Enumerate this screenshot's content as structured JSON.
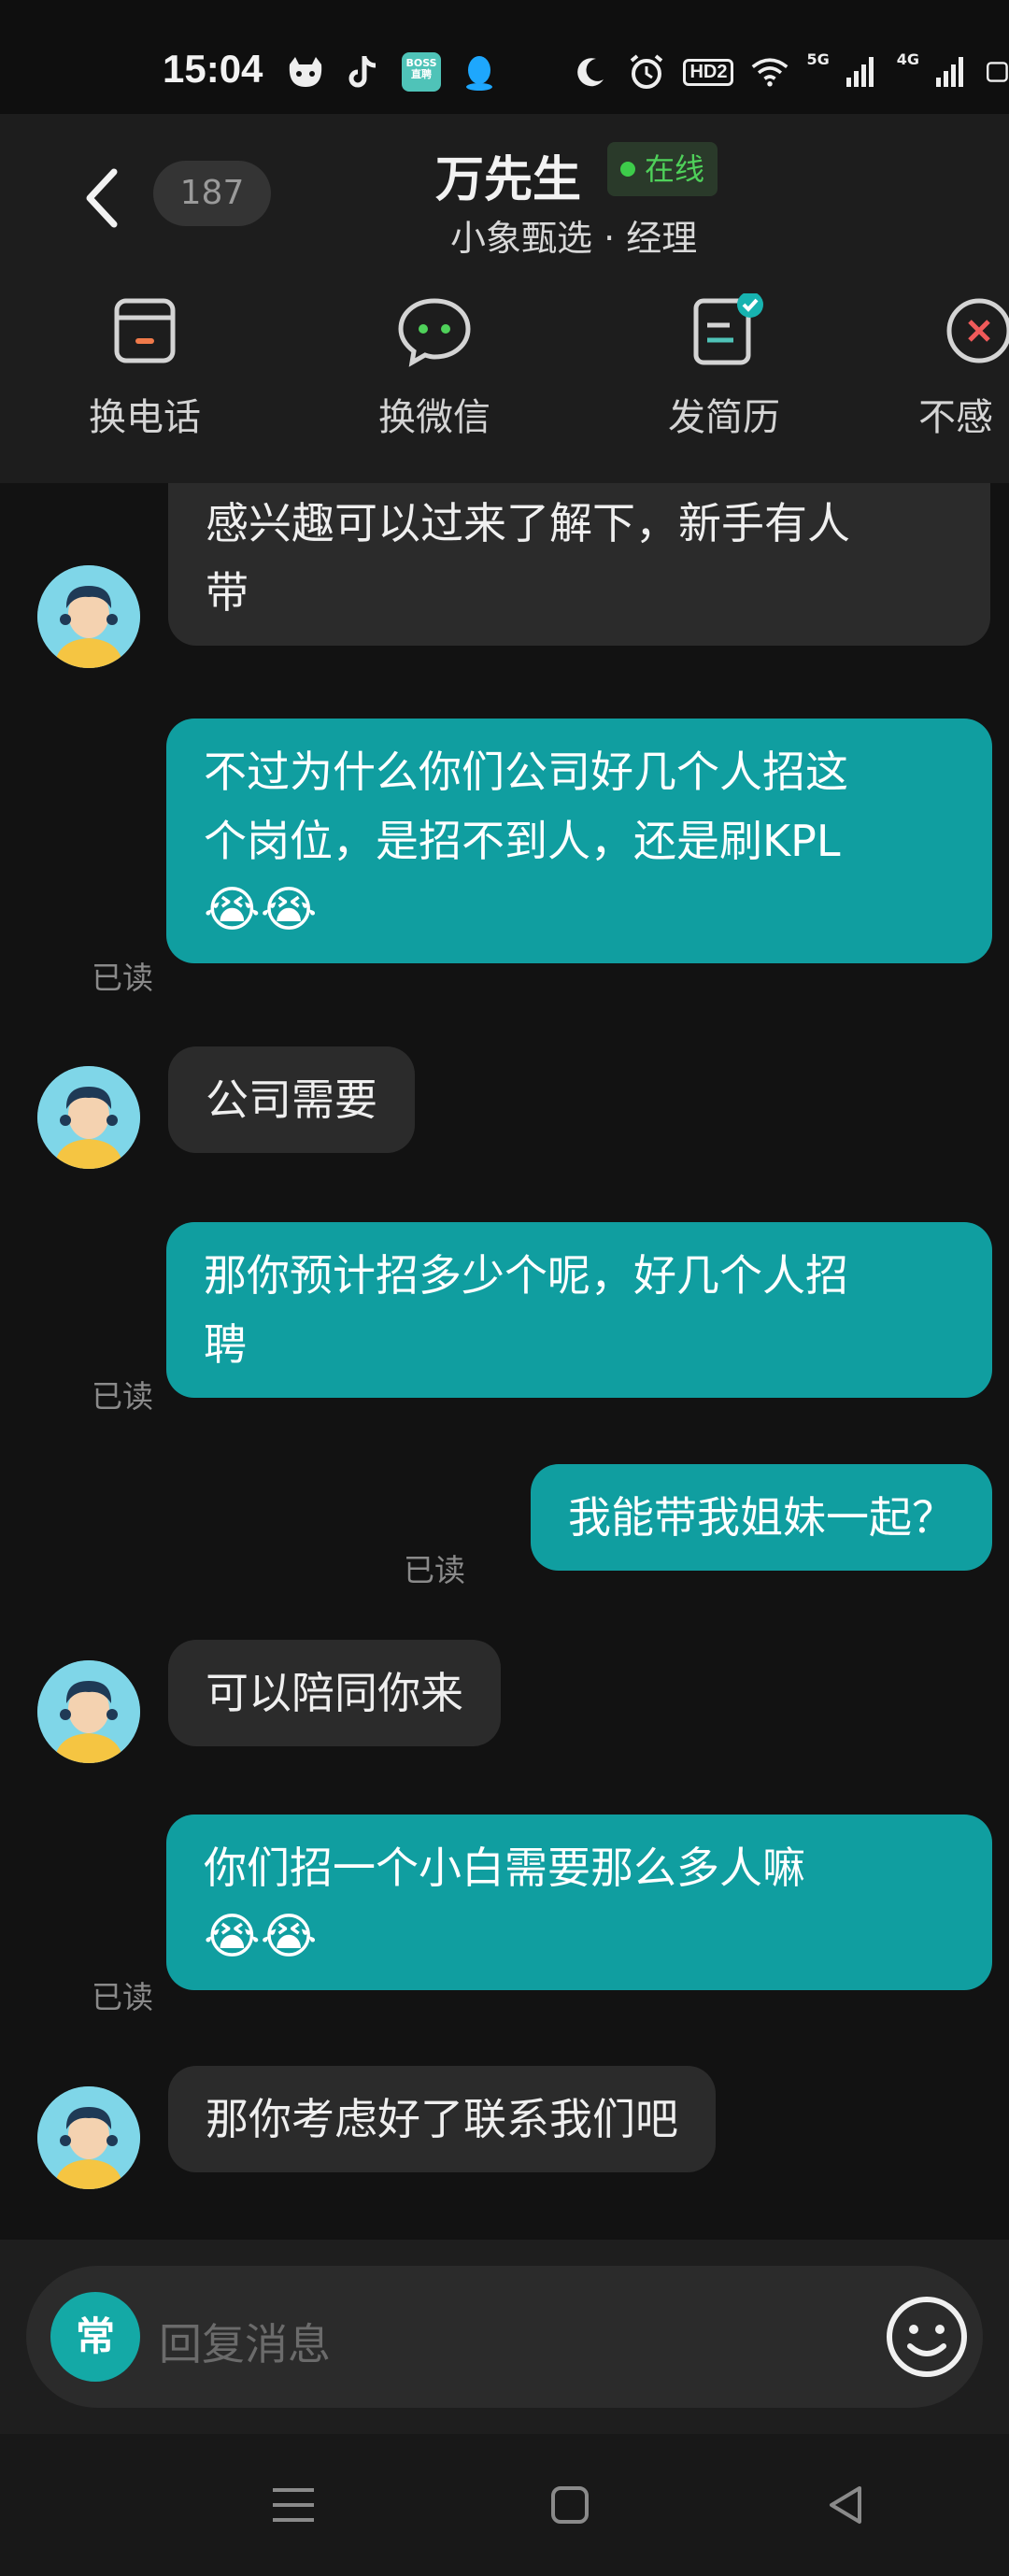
{
  "status_bar": {
    "time": "15:04",
    "app_icons": [
      "cat-app-icon",
      "tiktok-icon",
      "boss-zhipin-icon",
      "qq-icon"
    ],
    "boss_label": "BOSS直聘",
    "hd_label": "HD2",
    "net_5g": "5G",
    "net_4g": "4G",
    "system_icons": [
      "moon-icon",
      "alarm-icon",
      "hd-icon",
      "wifi-icon",
      "signal-5g-icon",
      "signal-4g-icon",
      "battery-icon"
    ]
  },
  "header": {
    "back_icon": "chevron-left-icon",
    "unread_count": "187",
    "contact_name": "万先生",
    "online_status": "在线",
    "contact_subtitle": "小象甄选 · 经理",
    "actions": [
      {
        "label": "换电话",
        "icon": "phone-card-icon"
      },
      {
        "label": "换微信",
        "icon": "wechat-bubble-icon"
      },
      {
        "label": "发简历",
        "icon": "resume-check-icon"
      },
      {
        "label": "不感",
        "icon": "not-interested-icon"
      }
    ]
  },
  "messages": [
    {
      "side": "in",
      "lines": [
        "感兴趣可以过来了解下，新手有人",
        "带"
      ]
    },
    {
      "side": "out",
      "lines": [
        "不过为什么你们公司好几个人招这",
        "个岗位，是招不到人，还是刷KPL"
      ],
      "emoji": "😭😭",
      "read": "已读"
    },
    {
      "side": "in",
      "lines": [
        "公司需要"
      ]
    },
    {
      "side": "out",
      "lines": [
        "那你预计招多少个呢，好几个人招",
        "聘"
      ],
      "read": "已读"
    },
    {
      "side": "out",
      "lines": [
        "我能带我姐妹一起？"
      ],
      "read": "已读"
    },
    {
      "side": "in",
      "lines": [
        "可以陪同你来"
      ]
    },
    {
      "side": "out",
      "lines": [
        "你们招一个小白需要那么多人嘛"
      ],
      "emoji": "😭😭",
      "read": "已读"
    },
    {
      "side": "in",
      "lines": [
        "那你考虑好了联系我们吧"
      ]
    }
  ],
  "input": {
    "common_phrase_label": "常",
    "placeholder": "回复消息",
    "emoji_icon": "smiley-icon"
  },
  "navbar": {
    "icons": [
      "menu-icon",
      "home-square-icon",
      "back-triangle-icon"
    ]
  },
  "colors": {
    "accent_teal": "#109ea0",
    "online_green": "#3dcc4a",
    "incoming_bubble": "#2b2b2b",
    "background": "#121212"
  }
}
